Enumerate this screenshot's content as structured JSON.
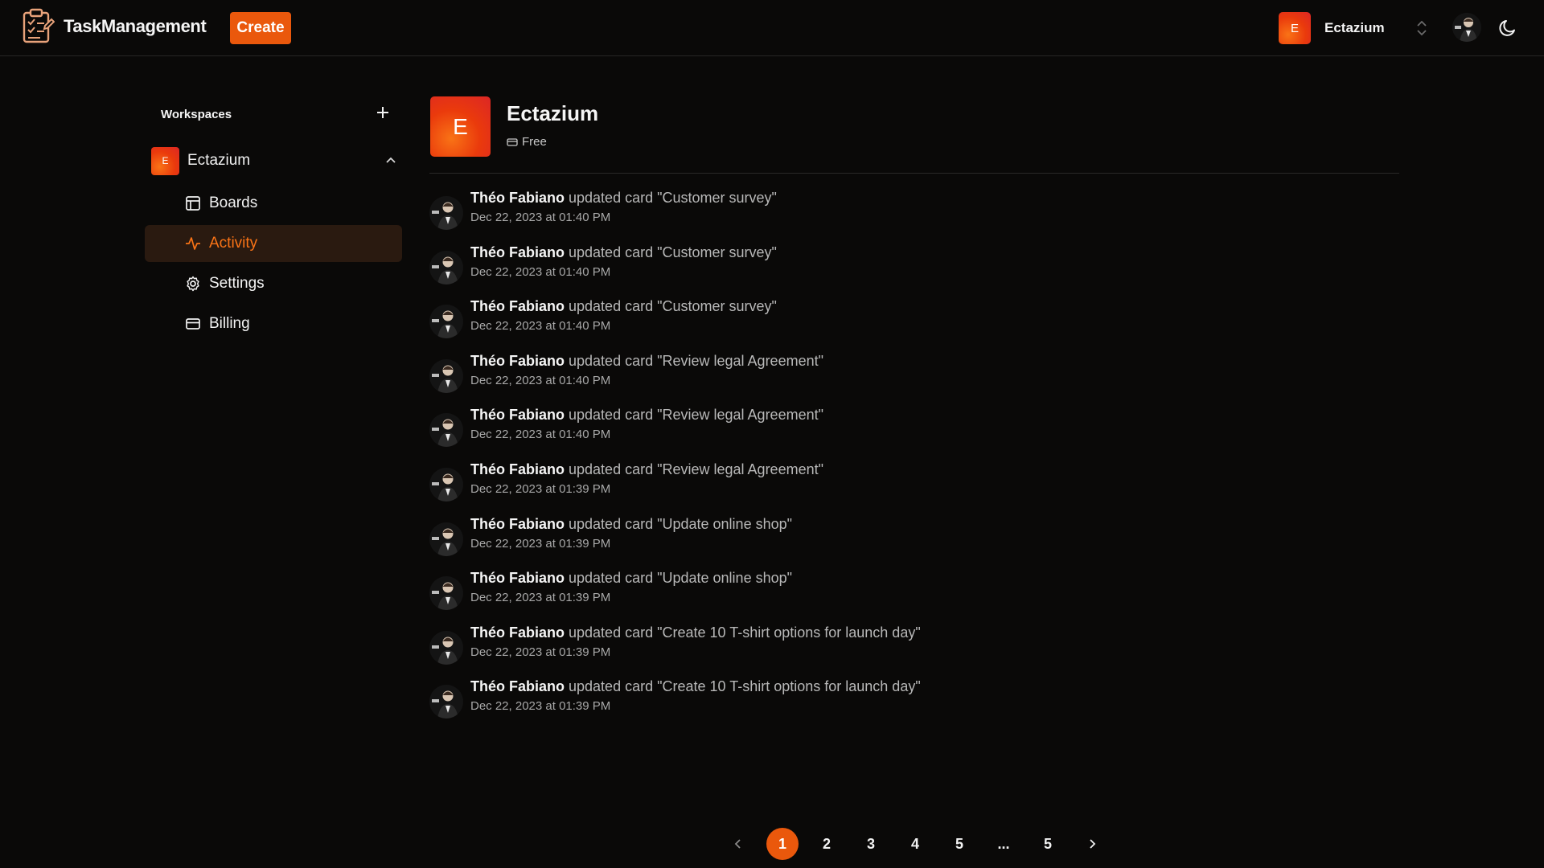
{
  "app": {
    "name": "TaskManagement",
    "create_label": "Create",
    "accent": "#ea580c"
  },
  "topbar": {
    "workspace_initial": "E",
    "workspace_name": "Ectazium",
    "icons": [
      "clipboard-logo-icon",
      "chevron-updown-icon",
      "user-avatar",
      "moon-icon"
    ]
  },
  "sidebar": {
    "header": "Workspaces",
    "workspace": {
      "initial": "E",
      "name": "Ectazium"
    },
    "items": [
      {
        "label": "Boards",
        "icon": "board-icon",
        "active": false
      },
      {
        "label": "Activity",
        "icon": "activity-icon",
        "active": true
      },
      {
        "label": "Settings",
        "icon": "gear-icon",
        "active": false
      },
      {
        "label": "Billing",
        "icon": "credit-card-icon",
        "active": false
      }
    ]
  },
  "organization": {
    "initial": "E",
    "name": "Ectazium",
    "plan": "Free"
  },
  "activity": [
    {
      "user": "Théo Fabiano",
      "action": "updated card \"Customer survey\"",
      "time": "Dec 22, 2023 at 01:40 PM"
    },
    {
      "user": "Théo Fabiano",
      "action": "updated card \"Customer survey\"",
      "time": "Dec 22, 2023 at 01:40 PM"
    },
    {
      "user": "Théo Fabiano",
      "action": "updated card \"Customer survey\"",
      "time": "Dec 22, 2023 at 01:40 PM"
    },
    {
      "user": "Théo Fabiano",
      "action": "updated card \"Review legal Agreement\"",
      "time": "Dec 22, 2023 at 01:40 PM"
    },
    {
      "user": "Théo Fabiano",
      "action": "updated card \"Review legal Agreement\"",
      "time": "Dec 22, 2023 at 01:40 PM"
    },
    {
      "user": "Théo Fabiano",
      "action": "updated card \"Review legal Agreement\"",
      "time": "Dec 22, 2023 at 01:39 PM"
    },
    {
      "user": "Théo Fabiano",
      "action": "updated card \"Update online shop\"",
      "time": "Dec 22, 2023 at 01:39 PM"
    },
    {
      "user": "Théo Fabiano",
      "action": "updated card \"Update online shop\"",
      "time": "Dec 22, 2023 at 01:39 PM"
    },
    {
      "user": "Théo Fabiano",
      "action": "updated card \"Create 10 T-shirt options for launch day\"",
      "time": "Dec 22, 2023 at 01:39 PM"
    },
    {
      "user": "Théo Fabiano",
      "action": "updated card \"Create 10 T-shirt options for launch day\"",
      "time": "Dec 22, 2023 at 01:39 PM"
    }
  ],
  "pagination": {
    "pages": [
      "1",
      "2",
      "3",
      "4",
      "5",
      "...",
      "5"
    ],
    "current": "1"
  }
}
